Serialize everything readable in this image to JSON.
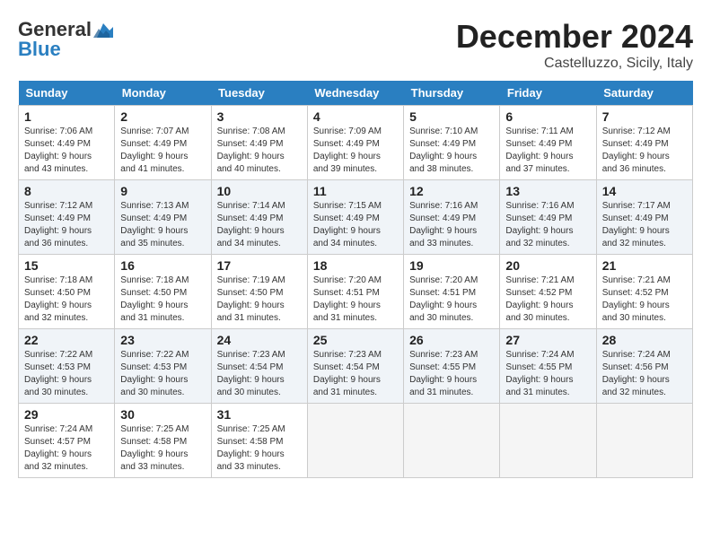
{
  "header": {
    "logo_line1": "General",
    "logo_line2": "Blue",
    "month_title": "December 2024",
    "location": "Castelluzzo, Sicily, Italy"
  },
  "days_of_week": [
    "Sunday",
    "Monday",
    "Tuesday",
    "Wednesday",
    "Thursday",
    "Friday",
    "Saturday"
  ],
  "weeks": [
    [
      {
        "day": "1",
        "sunrise": "Sunrise: 7:06 AM",
        "sunset": "Sunset: 4:49 PM",
        "daylight": "Daylight: 9 hours and 43 minutes."
      },
      {
        "day": "2",
        "sunrise": "Sunrise: 7:07 AM",
        "sunset": "Sunset: 4:49 PM",
        "daylight": "Daylight: 9 hours and 41 minutes."
      },
      {
        "day": "3",
        "sunrise": "Sunrise: 7:08 AM",
        "sunset": "Sunset: 4:49 PM",
        "daylight": "Daylight: 9 hours and 40 minutes."
      },
      {
        "day": "4",
        "sunrise": "Sunrise: 7:09 AM",
        "sunset": "Sunset: 4:49 PM",
        "daylight": "Daylight: 9 hours and 39 minutes."
      },
      {
        "day": "5",
        "sunrise": "Sunrise: 7:10 AM",
        "sunset": "Sunset: 4:49 PM",
        "daylight": "Daylight: 9 hours and 38 minutes."
      },
      {
        "day": "6",
        "sunrise": "Sunrise: 7:11 AM",
        "sunset": "Sunset: 4:49 PM",
        "daylight": "Daylight: 9 hours and 37 minutes."
      },
      {
        "day": "7",
        "sunrise": "Sunrise: 7:12 AM",
        "sunset": "Sunset: 4:49 PM",
        "daylight": "Daylight: 9 hours and 36 minutes."
      }
    ],
    [
      {
        "day": "8",
        "sunrise": "Sunrise: 7:12 AM",
        "sunset": "Sunset: 4:49 PM",
        "daylight": "Daylight: 9 hours and 36 minutes."
      },
      {
        "day": "9",
        "sunrise": "Sunrise: 7:13 AM",
        "sunset": "Sunset: 4:49 PM",
        "daylight": "Daylight: 9 hours and 35 minutes."
      },
      {
        "day": "10",
        "sunrise": "Sunrise: 7:14 AM",
        "sunset": "Sunset: 4:49 PM",
        "daylight": "Daylight: 9 hours and 34 minutes."
      },
      {
        "day": "11",
        "sunrise": "Sunrise: 7:15 AM",
        "sunset": "Sunset: 4:49 PM",
        "daylight": "Daylight: 9 hours and 34 minutes."
      },
      {
        "day": "12",
        "sunrise": "Sunrise: 7:16 AM",
        "sunset": "Sunset: 4:49 PM",
        "daylight": "Daylight: 9 hours and 33 minutes."
      },
      {
        "day": "13",
        "sunrise": "Sunrise: 7:16 AM",
        "sunset": "Sunset: 4:49 PM",
        "daylight": "Daylight: 9 hours and 32 minutes."
      },
      {
        "day": "14",
        "sunrise": "Sunrise: 7:17 AM",
        "sunset": "Sunset: 4:49 PM",
        "daylight": "Daylight: 9 hours and 32 minutes."
      }
    ],
    [
      {
        "day": "15",
        "sunrise": "Sunrise: 7:18 AM",
        "sunset": "Sunset: 4:50 PM",
        "daylight": "Daylight: 9 hours and 32 minutes."
      },
      {
        "day": "16",
        "sunrise": "Sunrise: 7:18 AM",
        "sunset": "Sunset: 4:50 PM",
        "daylight": "Daylight: 9 hours and 31 minutes."
      },
      {
        "day": "17",
        "sunrise": "Sunrise: 7:19 AM",
        "sunset": "Sunset: 4:50 PM",
        "daylight": "Daylight: 9 hours and 31 minutes."
      },
      {
        "day": "18",
        "sunrise": "Sunrise: 7:20 AM",
        "sunset": "Sunset: 4:51 PM",
        "daylight": "Daylight: 9 hours and 31 minutes."
      },
      {
        "day": "19",
        "sunrise": "Sunrise: 7:20 AM",
        "sunset": "Sunset: 4:51 PM",
        "daylight": "Daylight: 9 hours and 30 minutes."
      },
      {
        "day": "20",
        "sunrise": "Sunrise: 7:21 AM",
        "sunset": "Sunset: 4:52 PM",
        "daylight": "Daylight: 9 hours and 30 minutes."
      },
      {
        "day": "21",
        "sunrise": "Sunrise: 7:21 AM",
        "sunset": "Sunset: 4:52 PM",
        "daylight": "Daylight: 9 hours and 30 minutes."
      }
    ],
    [
      {
        "day": "22",
        "sunrise": "Sunrise: 7:22 AM",
        "sunset": "Sunset: 4:53 PM",
        "daylight": "Daylight: 9 hours and 30 minutes."
      },
      {
        "day": "23",
        "sunrise": "Sunrise: 7:22 AM",
        "sunset": "Sunset: 4:53 PM",
        "daylight": "Daylight: 9 hours and 30 minutes."
      },
      {
        "day": "24",
        "sunrise": "Sunrise: 7:23 AM",
        "sunset": "Sunset: 4:54 PM",
        "daylight": "Daylight: 9 hours and 30 minutes."
      },
      {
        "day": "25",
        "sunrise": "Sunrise: 7:23 AM",
        "sunset": "Sunset: 4:54 PM",
        "daylight": "Daylight: 9 hours and 31 minutes."
      },
      {
        "day": "26",
        "sunrise": "Sunrise: 7:23 AM",
        "sunset": "Sunset: 4:55 PM",
        "daylight": "Daylight: 9 hours and 31 minutes."
      },
      {
        "day": "27",
        "sunrise": "Sunrise: 7:24 AM",
        "sunset": "Sunset: 4:55 PM",
        "daylight": "Daylight: 9 hours and 31 minutes."
      },
      {
        "day": "28",
        "sunrise": "Sunrise: 7:24 AM",
        "sunset": "Sunset: 4:56 PM",
        "daylight": "Daylight: 9 hours and 32 minutes."
      }
    ],
    [
      {
        "day": "29",
        "sunrise": "Sunrise: 7:24 AM",
        "sunset": "Sunset: 4:57 PM",
        "daylight": "Daylight: 9 hours and 32 minutes."
      },
      {
        "day": "30",
        "sunrise": "Sunrise: 7:25 AM",
        "sunset": "Sunset: 4:58 PM",
        "daylight": "Daylight: 9 hours and 33 minutes."
      },
      {
        "day": "31",
        "sunrise": "Sunrise: 7:25 AM",
        "sunset": "Sunset: 4:58 PM",
        "daylight": "Daylight: 9 hours and 33 minutes."
      },
      null,
      null,
      null,
      null
    ]
  ]
}
